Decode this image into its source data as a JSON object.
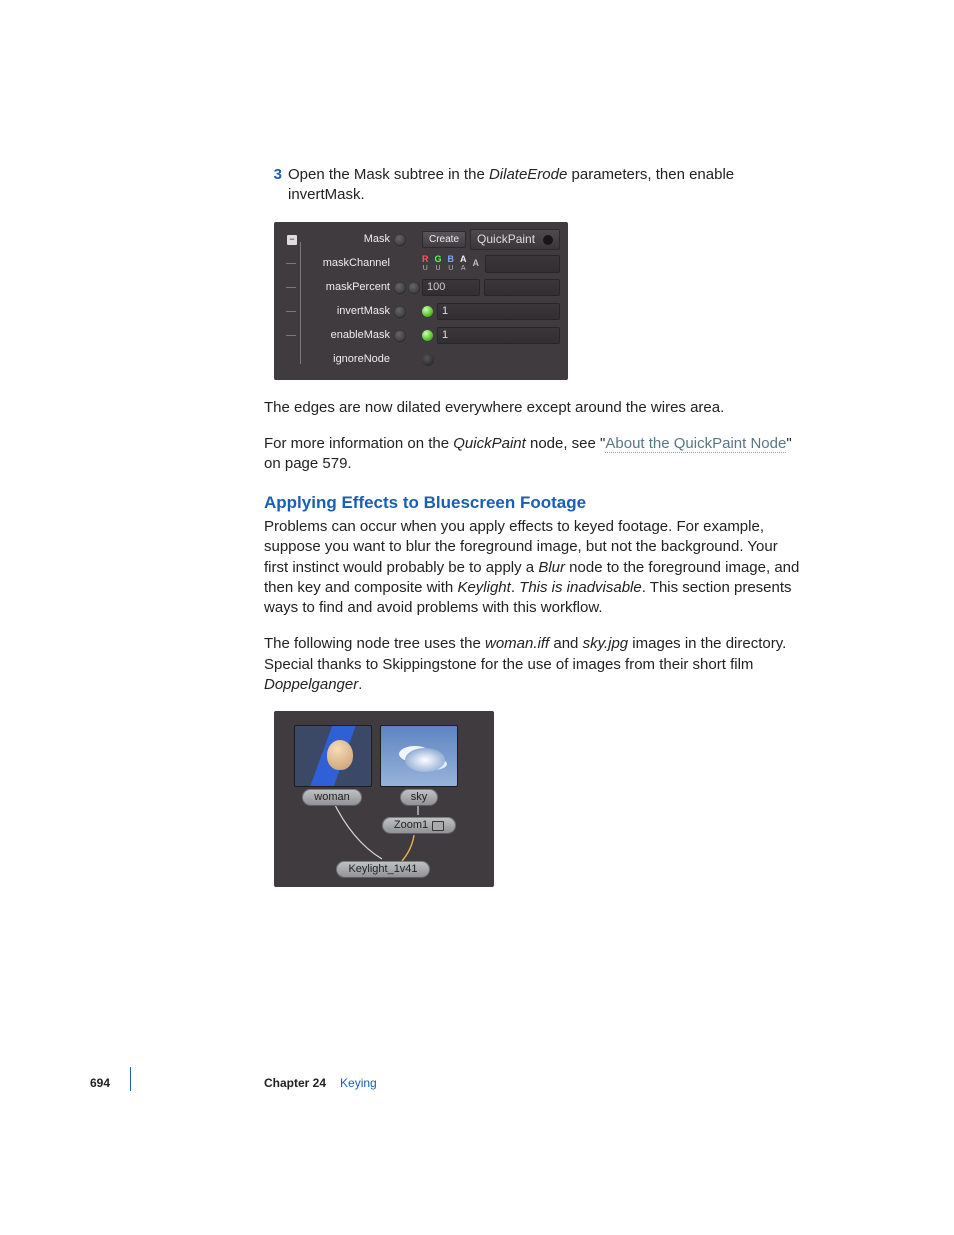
{
  "step": {
    "num": "3",
    "text_a": "Open the Mask subtree in the ",
    "text_italic": "DilateErode",
    "text_b": " parameters, then enable invertMask."
  },
  "panel": {
    "rows": {
      "mask_label": "Mask",
      "create_btn": "Create",
      "quickpaint": "QuickPaint",
      "maskChannel_label": "maskChannel",
      "chan_R": "R",
      "chan_G": "G",
      "chan_B": "B",
      "chan_A": "A",
      "chan_Z": "A",
      "maskPercent_label": "maskPercent",
      "maskPercent_val": "100",
      "invertMask_label": "invertMask",
      "invertMask_val": "1",
      "enableMask_label": "enableMask",
      "enableMask_val": "1",
      "ignoreNode_label": "ignoreNode"
    }
  },
  "para1": "The edges are now dilated everywhere except around the wires area.",
  "para2_a": "For more information on the ",
  "para2_i": "QuickPaint",
  "para2_b": " node, see \"",
  "para2_link": "About the QuickPaint Node",
  "para2_c": "\" on page 579.",
  "section_head": "Applying Effects to Bluescreen Footage",
  "para3_a": "Problems can occur when you apply effects to keyed footage. For example, suppose you want to blur the foreground image, but not the background. Your first instinct would probably be to apply a ",
  "para3_i1": "Blur",
  "para3_b": " node to the foreground image, and then key and composite with ",
  "para3_i2": "Keylight",
  "para3_c": ". ",
  "para3_i3": "This is inadvisable",
  "para3_d": ". This section presents ways to find and avoid problems with this workflow.",
  "para4_a": "The following node tree uses the ",
  "para4_i1": "woman.iff",
  "para4_b": " and ",
  "para4_i2": "sky.jpg",
  "para4_c": " images in the directory. Special thanks to Skippingstone for the use of images from their short film ",
  "para4_i3": "Doppelganger",
  "para4_d": ".",
  "nodes": {
    "woman": "woman",
    "sky": "sky",
    "zoom": "Zoom1",
    "keylight": "Keylight_1v41"
  },
  "footer": {
    "page_num": "694",
    "chapter_label": "Chapter 24",
    "chapter_name": "Keying"
  }
}
